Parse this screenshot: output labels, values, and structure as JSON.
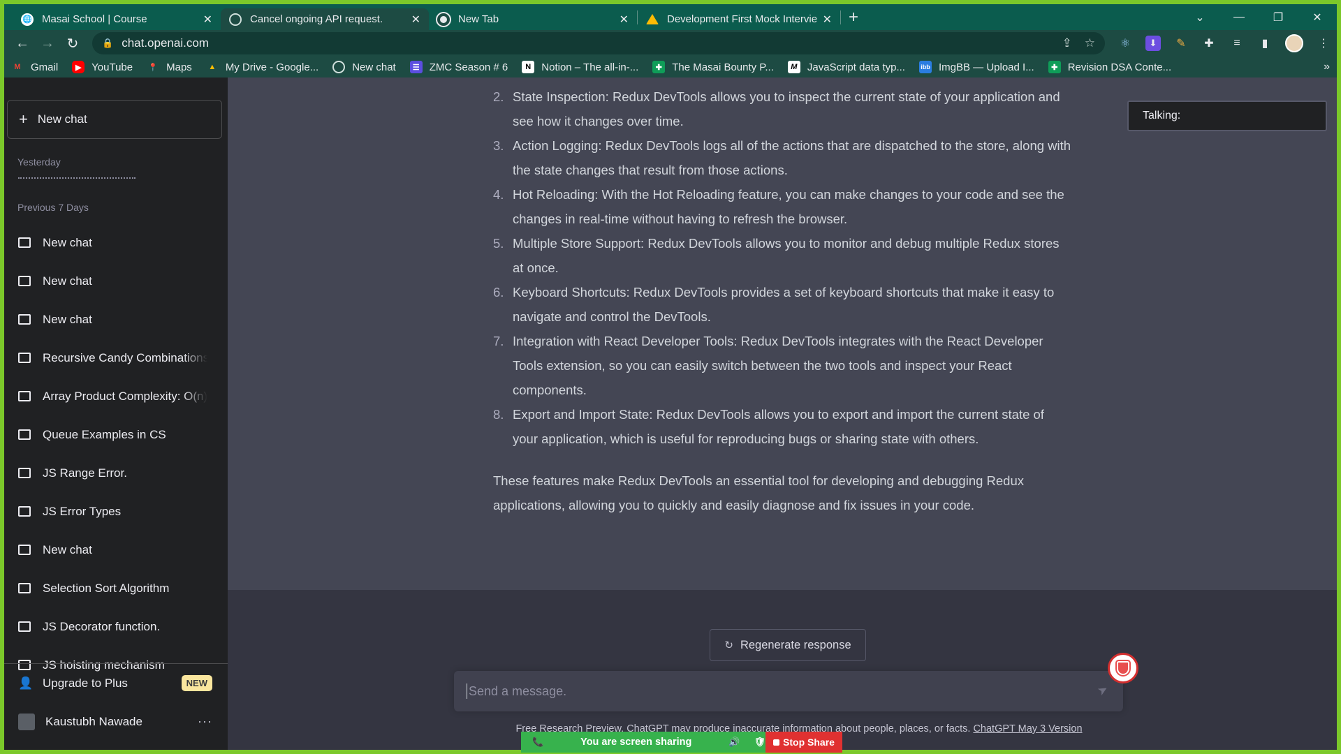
{
  "browser": {
    "tabs": [
      {
        "title": "Masai School | Course",
        "icon": "globe-icon",
        "active": false
      },
      {
        "title": "Cancel ongoing API request.",
        "icon": "openai-icon",
        "active": true
      },
      {
        "title": "New Tab",
        "icon": "chrome-icon",
        "active": false
      },
      {
        "title": "Development First Mock Intervie",
        "icon": "drive-icon",
        "active": false
      }
    ],
    "url": "chat.openai.com",
    "bookmarks": [
      {
        "label": "Gmail",
        "icon": "gmail-icon"
      },
      {
        "label": "YouTube",
        "icon": "youtube-icon"
      },
      {
        "label": "Maps",
        "icon": "maps-icon"
      },
      {
        "label": "My Drive - Google...",
        "icon": "drive-icon"
      },
      {
        "label": "New chat",
        "icon": "openai-icon"
      },
      {
        "label": "ZMC Season # 6",
        "icon": "list-icon"
      },
      {
        "label": "Notion – The all-in-...",
        "icon": "notion-icon"
      },
      {
        "label": "The Masai Bounty P...",
        "icon": "sheets-icon"
      },
      {
        "label": "JavaScript data typ...",
        "icon": "medium-icon"
      },
      {
        "label": "ImgBB — Upload I...",
        "icon": "imgbb-icon"
      },
      {
        "label": "Revision DSA Conte...",
        "icon": "sheets-icon"
      }
    ]
  },
  "sidebar": {
    "new_chat": "New chat",
    "group_yesterday": "Yesterday",
    "group_prev7": "Previous 7 Days",
    "items": [
      {
        "label": "New chat"
      },
      {
        "label": "New chat"
      },
      {
        "label": "New chat"
      },
      {
        "label": "Recursive Candy Combinations"
      },
      {
        "label": "Array Product Complexity: O(n)"
      },
      {
        "label": "Queue Examples in CS"
      },
      {
        "label": "JS Range Error."
      },
      {
        "label": "JS Error Types"
      },
      {
        "label": "New chat"
      },
      {
        "label": "Selection Sort Algorithm"
      },
      {
        "label": "JS Decorator function."
      },
      {
        "label": "JS hoisting mechanism"
      }
    ],
    "upgrade": "Upgrade to Plus",
    "upgrade_badge": "NEW",
    "user_name": "Kaustubh Nawade"
  },
  "answer": {
    "items": [
      {
        "num": "2.",
        "text": "State Inspection: Redux DevTools allows you to inspect the current state of your application and see how it changes over time."
      },
      {
        "num": "3.",
        "text": "Action Logging: Redux DevTools logs all of the actions that are dispatched to the store, along with the state changes that result from those actions."
      },
      {
        "num": "4.",
        "text": "Hot Reloading: With the Hot Reloading feature, you can make changes to your code and see the changes in real-time without having to refresh the browser."
      },
      {
        "num": "5.",
        "text": "Multiple Store Support: Redux DevTools allows you to monitor and debug multiple Redux stores at once."
      },
      {
        "num": "6.",
        "text": "Keyboard Shortcuts: Redux DevTools provides a set of keyboard shortcuts that make it easy to navigate and control the DevTools."
      },
      {
        "num": "7.",
        "text": "Integration with React Developer Tools: Redux DevTools integrates with the React Developer Tools extension, so you can easily switch between the two tools and inspect your React components."
      },
      {
        "num": "8.",
        "text": "Export and Import State: Redux DevTools allows you to export and import the current state of your application, which is useful for reproducing bugs or sharing state with others."
      }
    ],
    "conclusion": "These features make Redux DevTools an essential tool for developing and debugging Redux applications, allowing you to quickly and easily diagnose and fix issues in your code."
  },
  "overlay": {
    "talking": "Talking:"
  },
  "composer": {
    "regenerate": "Regenerate response",
    "placeholder": "Send a message.",
    "disclaimer": "Free Research Preview. ChatGPT may produce inaccurate information about people, places, or facts.",
    "version_link": "ChatGPT May 3 Version"
  },
  "screenshare": {
    "status": "You are screen sharing",
    "stop": "Stop Share"
  },
  "colors": {
    "accent_border": "#7bc82a",
    "chrome_tabbar": "#0b5c4e",
    "sidebar": "#202123",
    "main": "#444654",
    "stop_share": "#e03131",
    "share_bar": "#37b24d"
  }
}
